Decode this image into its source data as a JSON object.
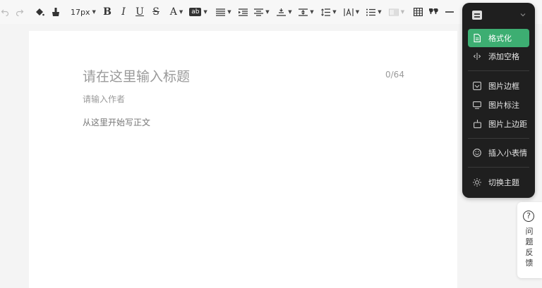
{
  "toolbar": {
    "font_size": "17px",
    "bold": "B",
    "italic": "I",
    "underline": "U",
    "strike": "S",
    "font_color": "A",
    "highlight": "ab"
  },
  "editor": {
    "title_placeholder": "请在这里输入标题",
    "title_counter": "0/64",
    "author_placeholder": "请输入作者",
    "body_placeholder": "从这里开始写正文"
  },
  "panel": {
    "items": [
      {
        "label": "格式化",
        "icon": "format-doc-icon",
        "active": true
      },
      {
        "label": "添加空格",
        "icon": "add-space-icon",
        "active": false
      },
      {
        "label": "图片边框",
        "icon": "image-border-icon",
        "active": false
      },
      {
        "label": "图片标注",
        "icon": "image-caption-icon",
        "active": false
      },
      {
        "label": "图片上边距",
        "icon": "image-margin-icon",
        "active": false
      },
      {
        "label": "插入小表情",
        "icon": "emoji-icon",
        "active": false
      },
      {
        "label": "切换主题",
        "icon": "theme-sun-icon",
        "active": false
      }
    ],
    "accent_color": "#3dae72"
  },
  "feedback": {
    "icon": "?",
    "label_line1": "问",
    "label_line2": "题",
    "label_line3": "反",
    "label_line4": "馈"
  }
}
